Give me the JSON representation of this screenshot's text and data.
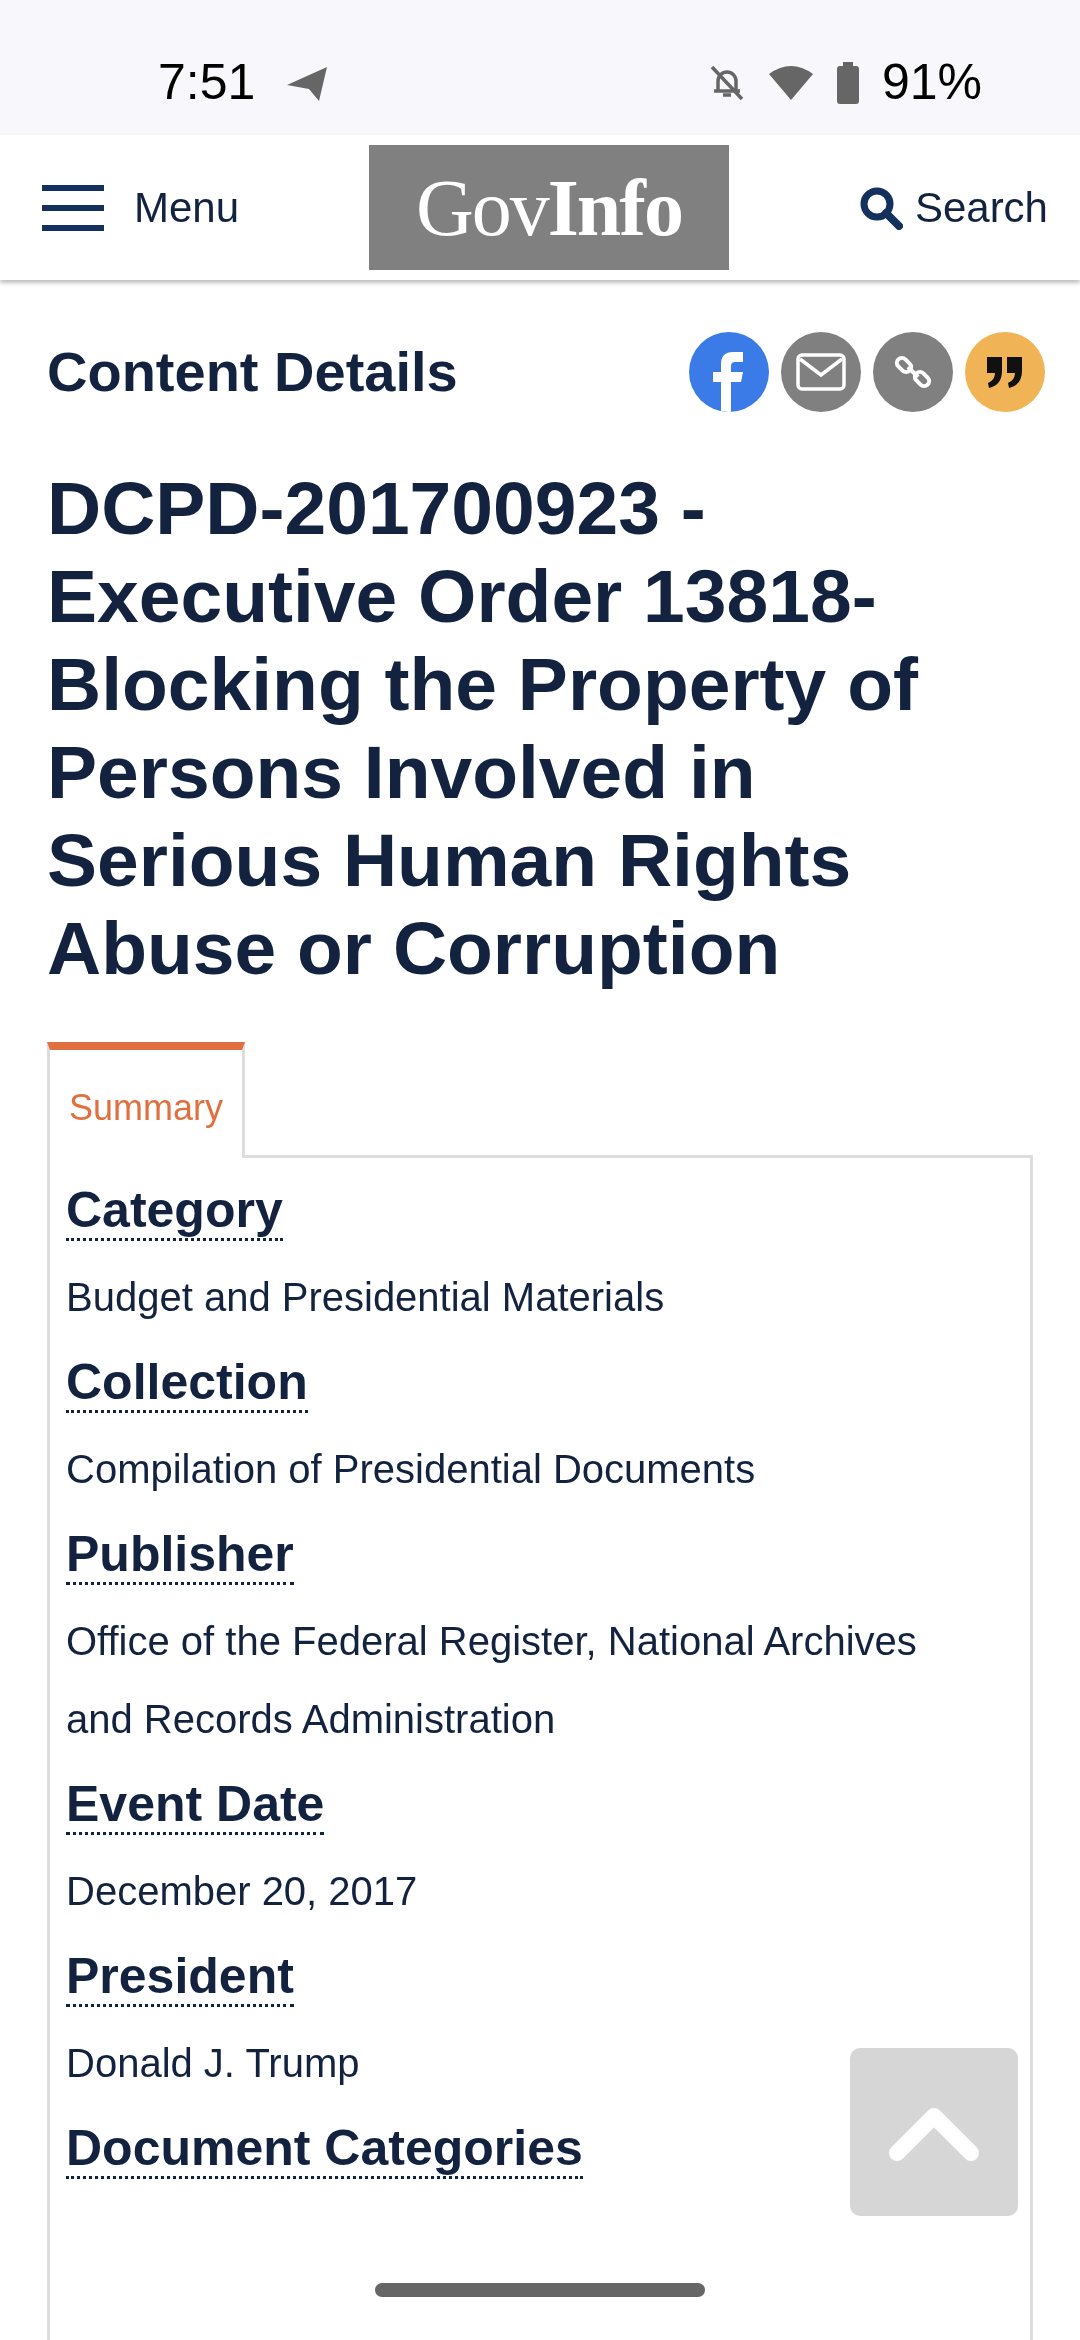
{
  "status_bar": {
    "time": "7:51",
    "battery": "91%"
  },
  "header": {
    "menu_label": "Menu",
    "logo": "Gov**Info**",
    "search_label": "Search"
  },
  "section_heading": "Content Details",
  "title": "DCPD-201700923 - Executive Order 13818-Blocking the Property of Persons Involved in Serious Human Rights Abuse or Corruption",
  "tabs": [
    {
      "label": "Summary",
      "selected": true
    }
  ],
  "details": [
    {
      "label": "Category",
      "value": "Budget and Presidential Materials"
    },
    {
      "label": "Collection",
      "value": "Compilation of Presidential Documents"
    },
    {
      "label": "Publisher",
      "value": "Office of the Federal Register, National Archives and Records Administration"
    },
    {
      "label": "Event Date",
      "value": "December 20, 2017"
    },
    {
      "label": "President",
      "value": "Donald J. Trump"
    },
    {
      "label": "Document Categories"
    }
  ]
}
